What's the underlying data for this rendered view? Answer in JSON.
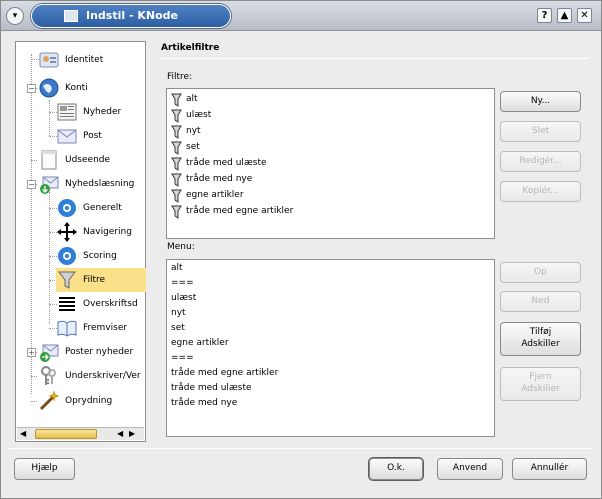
{
  "titlebar": {
    "title": "Indstil - KNode"
  },
  "titlebar_buttons": {
    "help": "?",
    "shade": "▲",
    "close": "✕",
    "menu": "▾"
  },
  "tree": {
    "items": [
      {
        "label": "Identitet"
      },
      {
        "label": "Konti"
      },
      {
        "label": "Nyheder"
      },
      {
        "label": "Post"
      },
      {
        "label": "Udseende"
      },
      {
        "label": "Nyhedslæsning"
      },
      {
        "label": "Generelt"
      },
      {
        "label": "Navigering"
      },
      {
        "label": "Scoring"
      },
      {
        "label": "Filtre"
      },
      {
        "label": "Overskriftsd"
      },
      {
        "label": "Fremviser"
      },
      {
        "label": "Poster nyheder"
      },
      {
        "label": "Underskriver/Ver"
      },
      {
        "label": "Oprydning"
      }
    ],
    "selected": "Filtre"
  },
  "page": {
    "title": "Artikelfiltre",
    "filters_label": "Filtre:",
    "menu_label": "Menu:"
  },
  "filters": [
    "alt",
    "ulæst",
    "nyt",
    "set",
    "tråde med ulæste",
    "tråde med nye",
    "egne artikler",
    "tråde med egne artikler"
  ],
  "menu": [
    "alt",
    "===",
    "ulæst",
    "nyt",
    "set",
    "egne artikler",
    "===",
    "tråde med egne artikler",
    "tråde med ulæste",
    "tråde med nye"
  ],
  "buttons": {
    "new": "Ny...",
    "delete": "Slet",
    "edit": "Redigér...",
    "copy": "Kopiér...",
    "up": "Op",
    "down": "Ned",
    "add_separator_1": "Tilføj",
    "add_separator_2": "Adskiller",
    "remove_separator_1": "Fjern",
    "remove_separator_2": "Adskiller"
  },
  "footer": {
    "help": "Hjælp",
    "ok": "O.k.",
    "apply": "Anvend",
    "cancel": "Annullér"
  },
  "colors": {
    "selection": "#fbe08a",
    "title_accent": "#2c5ea3"
  }
}
